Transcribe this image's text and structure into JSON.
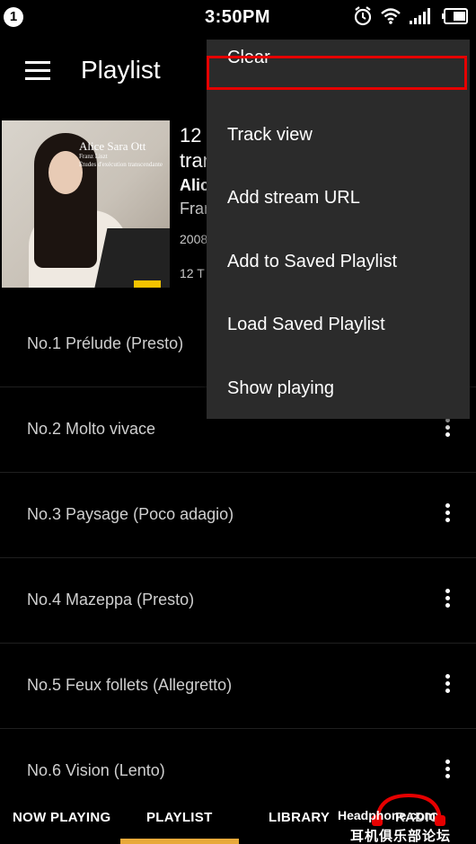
{
  "status_bar": {
    "notification_count": "1",
    "time": "3:50PM",
    "icons": [
      "alarm-icon",
      "wifi-icon",
      "signal-icon",
      "battery-icon"
    ]
  },
  "app_bar": {
    "title": "Playlist",
    "menu_icon": "hamburger-icon"
  },
  "album": {
    "art_artist": "Alice Sara Ott",
    "art_composer": "Franz Liszt",
    "art_subtitle": "Études d'exécution transcendante",
    "line1": "12",
    "line2": "tran",
    "line3": "Alic",
    "line4": "Fran",
    "line5": "2008",
    "line6": "12 T"
  },
  "tracks": [
    {
      "title": "No.1 Prélude (Presto)"
    },
    {
      "title": "No.2 Molto vivace"
    },
    {
      "title": "No.3 Paysage (Poco adagio)"
    },
    {
      "title": "No.4 Mazeppa (Presto)"
    },
    {
      "title": "No.5 Feux follets (Allegretto)"
    },
    {
      "title": "No.6 Vision (Lento)"
    }
  ],
  "bottom_nav": {
    "tabs": [
      "NOW PLAYING",
      "PLAYLIST",
      "LIBRARY",
      "RADIO"
    ],
    "active": "PLAYLIST",
    "accent_color": "#e8a93a"
  },
  "watermark": {
    "top": "Headphone.com",
    "bottom": "耳机俱乐部论坛"
  },
  "overflow_menu": {
    "items": [
      "Clear",
      "Track view",
      "Add stream URL",
      "Add to Saved Playlist",
      "Load Saved Playlist",
      "Show playing"
    ],
    "highlighted": "Clear",
    "highlight_color": "#e60000"
  }
}
